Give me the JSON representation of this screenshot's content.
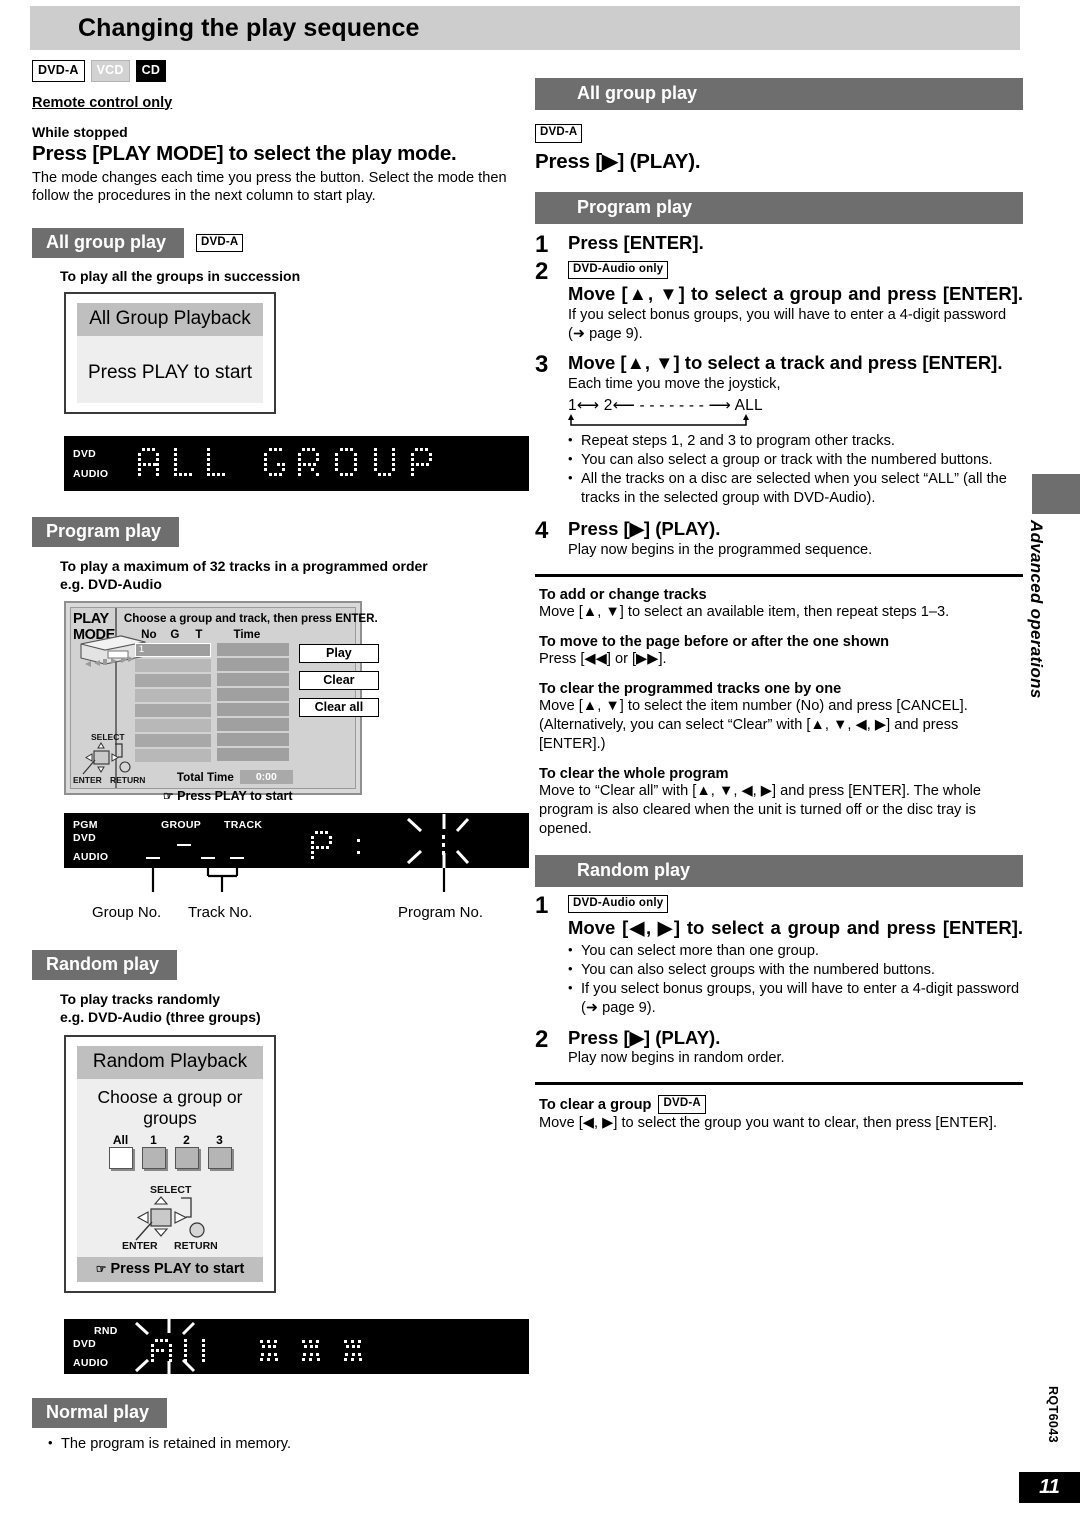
{
  "page": {
    "title": "Changing the play sequence",
    "footer_code": "RQT6043",
    "page_number": "11",
    "side_tab": "Advanced operations"
  },
  "intro": {
    "badges": [
      {
        "label": "DVD-A",
        "style": "outline"
      },
      {
        "label": "VCD",
        "style": "faded"
      },
      {
        "label": "CD",
        "style": "solid"
      }
    ],
    "remote_only": "Remote control only",
    "while_stopped": "While stopped",
    "heading": "Press [PLAY MODE] to select the play mode.",
    "body": "The mode changes each time you press the button. Select the mode then follow the procedures in the next column to start play."
  },
  "left": {
    "all_group": {
      "header": "All group play",
      "badge": "DVD-A",
      "caption": "To play all the groups in succession",
      "osd": {
        "title": "All Group Playback",
        "line": "Press PLAY to start"
      },
      "led": {
        "labels": [
          "DVD",
          "AUDIO"
        ],
        "text": "ALL  GROUP"
      }
    },
    "program": {
      "header": "Program play",
      "caption_line1": "To play a maximum of 32 tracks in a programmed order",
      "caption_line2": "e.g. DVD-Audio",
      "osd": {
        "panel_label": "PLAY MODE",
        "instruction": "Choose a group and track, then press ENTER.",
        "columns": [
          "No",
          "G",
          "T",
          "Time"
        ],
        "selected_row_value": "1",
        "rows": 8,
        "buttons": [
          "Play",
          "Clear",
          "Clear all"
        ],
        "total_time_label": "Total Time",
        "total_time_value": "0:00",
        "footer": "Press PLAY to start",
        "joystick": {
          "select": "SELECT",
          "enter": "ENTER",
          "return": "RETURN"
        }
      },
      "led": {
        "labels": [
          "PGM",
          "DVD",
          "AUDIO"
        ],
        "headers": [
          "GROUP",
          "TRACK"
        ],
        "display_chars": "P :"
      },
      "callouts": [
        "Group No.",
        "Track No.",
        "Program No."
      ]
    },
    "random": {
      "header": "Random play",
      "caption_line1": "To play tracks randomly",
      "caption_line2": "e.g. DVD-Audio (three groups)",
      "osd": {
        "title": "Random Playback",
        "prompt": "Choose  a group or groups",
        "group_buttons": [
          "All",
          "1",
          "2",
          "3"
        ],
        "selected_group": "All",
        "footer": "Press PLAY to start",
        "joystick": {
          "select": "SELECT",
          "enter": "ENTER",
          "return": "RETURN"
        }
      },
      "led": {
        "labels": [
          "RND",
          "DVD",
          "AUDIO"
        ],
        "display_chars": "A11"
      }
    },
    "normal": {
      "header": "Normal play",
      "note": "The program is retained in memory."
    }
  },
  "right": {
    "all_group": {
      "header": "All group  play",
      "badge": "DVD-A",
      "step": "Press [▶] (PLAY)."
    },
    "program": {
      "header": "Program play",
      "steps": [
        {
          "num": "1",
          "title": "Press [ENTER].",
          "badge": "",
          "sub": "",
          "bullets": []
        },
        {
          "num": "2",
          "badge": "DVD-Audio only",
          "title": "Move  [▲,  ▼]   to  select  a  group  and  press [ENTER].",
          "sub": "If you select bonus groups, you will have to enter a 4-digit password (➜ page 9).",
          "bullets": []
        },
        {
          "num": "3",
          "badge": "",
          "title": "Move [▲, ▼] to select a track and press [ENTER].",
          "sub": "Each time you move the joystick,",
          "cycle": "1⟷ 2⟵ - - - - - - - ⟶ ALL",
          "bullets": [
            "Repeat steps 1, 2 and 3 to program other tracks.",
            "You can also select a group or track with the numbered buttons.",
            "All the tracks on a disc are selected when you select “ALL” (all the tracks in the selected group with DVD-Audio)."
          ]
        },
        {
          "num": "4",
          "badge": "",
          "title": "Press [▶] (PLAY).",
          "sub": "Play now begins in the programmed sequence.",
          "bullets": []
        }
      ],
      "notes": [
        {
          "head": "To add or change tracks",
          "body": "Move [▲, ▼] to select an available item, then repeat steps 1–3."
        },
        {
          "head": "To move to the page before or after the one shown",
          "body": "Press [◀◀] or [▶▶]."
        },
        {
          "head": "To clear the programmed tracks one by one",
          "body": "Move [▲, ▼] to select the item number (No) and press [CANCEL]. (Alternatively, you can select “Clear” with [▲, ▼, ◀, ▶]  and press [ENTER].)"
        },
        {
          "head": "To clear the whole program",
          "body": "Move to “Clear all” with [▲, ▼, ◀, ▶]  and press [ENTER]. The whole program is also cleared when the unit is turned off or the disc tray is opened."
        }
      ]
    },
    "random": {
      "header": "Random play",
      "steps": [
        {
          "num": "1",
          "badge": "DVD-Audio only",
          "title": "Move  [◀,  ▶]   to  select  a  group  and  press [ENTER].",
          "bullets": [
            "You can select more than one group.",
            "You can also select groups with the numbered buttons.",
            "If you select bonus groups, you will have to enter a 4-digit password (➜ page 9)."
          ]
        },
        {
          "num": "2",
          "badge": "",
          "title": "Press [▶] (PLAY).",
          "sub": "Play now begins in random order."
        }
      ],
      "clear_group": {
        "head": "To clear a group",
        "badge": "DVD-A",
        "body": "Move [◀, ▶] to select the group you want to clear, then press [ENTER]."
      }
    }
  },
  "colors": {
    "header_bar": "#6e6e6e",
    "title_bar": "#cdcdcd",
    "osd_band": "#bfbfbf",
    "led_bg": "#000000"
  }
}
